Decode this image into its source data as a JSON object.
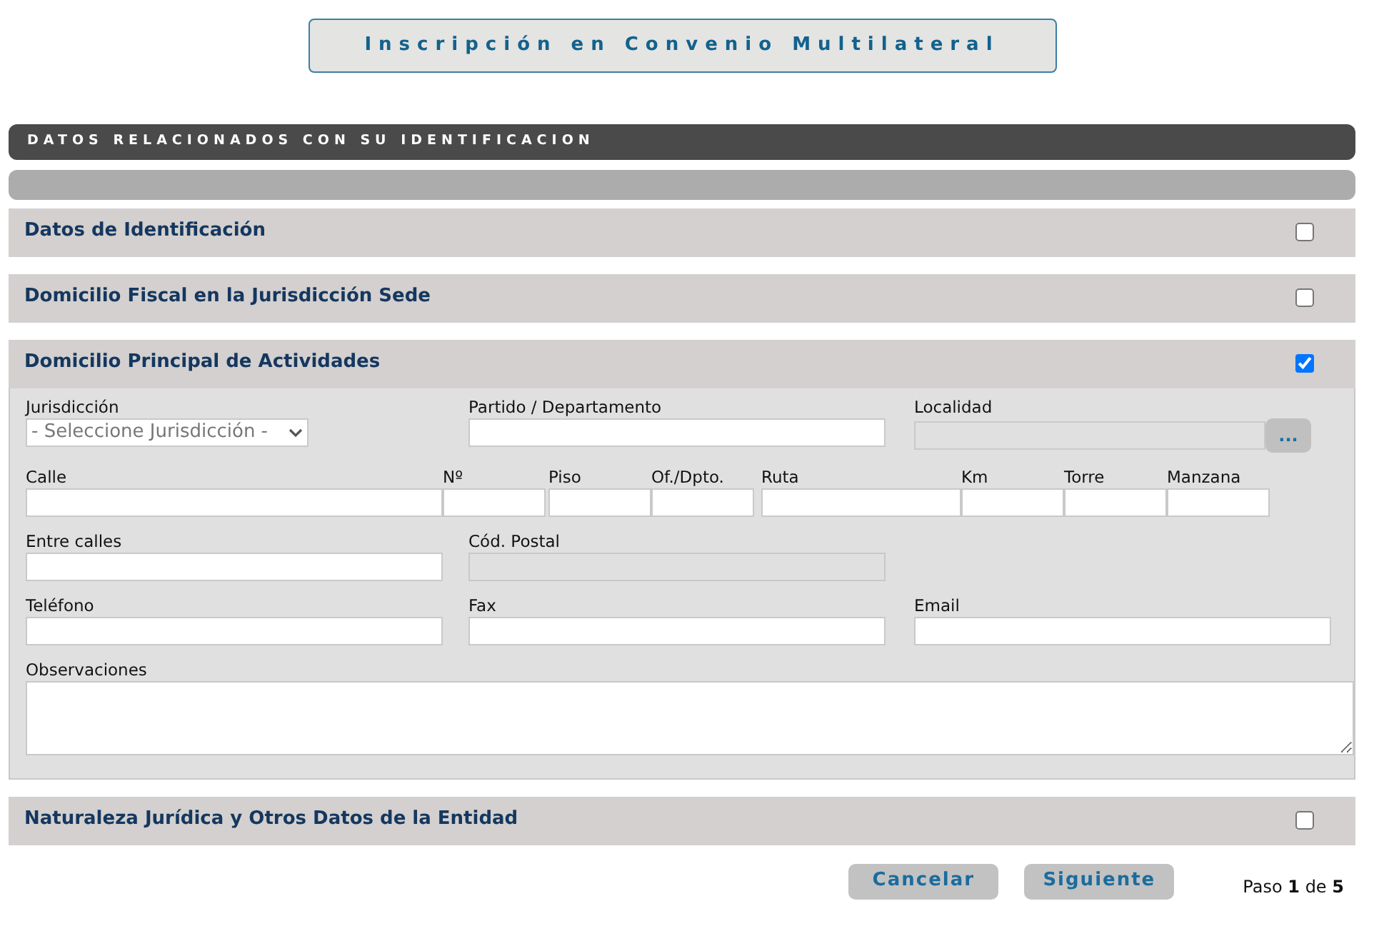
{
  "title": "Inscripción en Convenio Multilateral",
  "header_bar": "DATOS RELACIONADOS CON SU IDENTIFICACION",
  "sections": [
    {
      "title": "Datos de Identificación",
      "checked": false
    },
    {
      "title": "Domicilio Fiscal en la Jurisdicción Sede",
      "checked": false
    },
    {
      "title": "Domicilio Principal de Actividades",
      "checked": true,
      "form": [
        [
          {
            "label": "Jurisdicción",
            "kind": "select",
            "value": "- Seleccione Jurisdicción -"
          },
          {
            "label": "Partido / Departamento",
            "kind": "text",
            "disabled": false
          },
          {
            "label": "Localidad",
            "kind": "text",
            "disabled": true,
            "button": "..."
          }
        ],
        [
          {
            "label": "Calle",
            "kind": "text",
            "disabled": false
          },
          {
            "label": "Nº",
            "kind": "text",
            "disabled": false
          },
          {
            "label": "Piso",
            "kind": "text",
            "disabled": false
          },
          {
            "label": "Of./Dpto.",
            "kind": "text",
            "disabled": false
          },
          {
            "label": "Ruta",
            "kind": "text",
            "disabled": false
          },
          {
            "label": "Km",
            "kind": "text",
            "disabled": false
          },
          {
            "label": "Torre",
            "kind": "text",
            "disabled": false
          },
          {
            "label": "Manzana",
            "kind": "text",
            "disabled": false
          }
        ],
        [
          {
            "label": "Entre calles",
            "kind": "text",
            "disabled": false
          },
          {
            "label": "Cód. Postal",
            "kind": "text",
            "disabled": true
          }
        ],
        [
          {
            "label": "Teléfono",
            "kind": "text",
            "disabled": false
          },
          {
            "label": "Fax",
            "kind": "text",
            "disabled": false
          },
          {
            "label": "Email",
            "kind": "text",
            "disabled": false
          }
        ],
        [
          {
            "label": "Observaciones",
            "kind": "textarea",
            "disabled": false
          }
        ]
      ]
    },
    {
      "title": "Naturaleza Jurídica y Otros Datos de la Entidad",
      "checked": false
    }
  ],
  "buttons": [
    "Cancelar",
    "Siguiente"
  ],
  "step": "Paso **1** de **5**"
}
